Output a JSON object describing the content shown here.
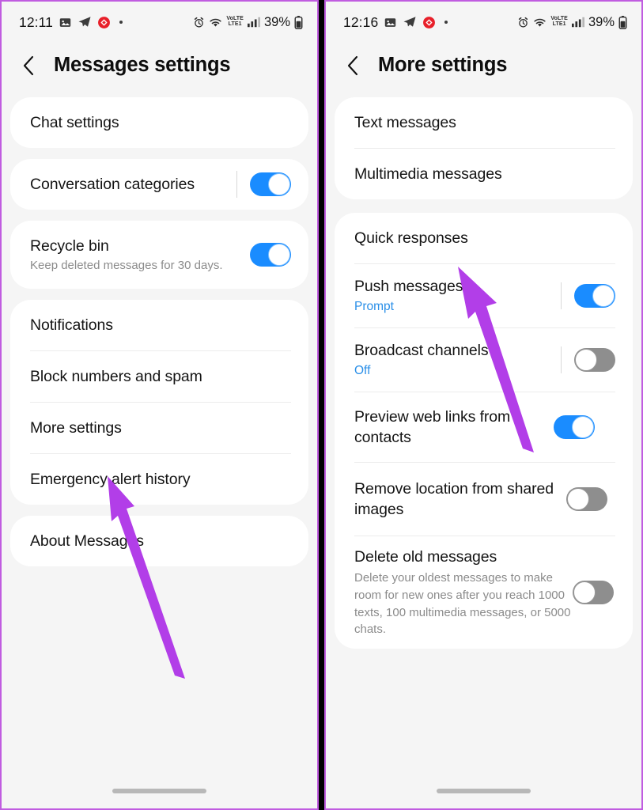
{
  "accent": {
    "toggle_on": "#1a8cff",
    "toggle_off": "#8e8e8e",
    "arrow": "#b23ee8",
    "frame_border": "#c05ce0",
    "link_blue": "#2a8fe8"
  },
  "left_phone": {
    "statusbar": {
      "time": "12:11",
      "battery": "39%",
      "network": "LTE1",
      "volte": "VoLTE",
      "icons_left": [
        "photo-icon",
        "telegram-icon",
        "red-badge-icon",
        "dot-icon"
      ],
      "icons_right": [
        "alarm-icon",
        "wifi-icon",
        "volte-icon",
        "signal-icon",
        "battery-icon"
      ]
    },
    "header": {
      "back": "back-chevron",
      "title": "Messages settings"
    },
    "cards": [
      {
        "rows": [
          {
            "title": "Chat settings",
            "sub": null,
            "toggle": null
          }
        ]
      },
      {
        "rows": [
          {
            "title": "Conversation categories",
            "sub": null,
            "toggle": "on"
          }
        ]
      },
      {
        "rows": [
          {
            "title": "Recycle bin",
            "sub": "Keep deleted messages for 30 days.",
            "toggle": "on"
          }
        ]
      },
      {
        "rows": [
          {
            "title": "Notifications",
            "sub": null,
            "toggle": null
          },
          {
            "title": "Block numbers and spam",
            "sub": null,
            "toggle": null
          },
          {
            "title": "More settings",
            "sub": null,
            "toggle": null
          },
          {
            "title": "Emergency alert history",
            "sub": null,
            "toggle": null
          }
        ]
      },
      {
        "rows": [
          {
            "title": "About Messages",
            "sub": null,
            "toggle": null
          }
        ]
      }
    ]
  },
  "right_phone": {
    "statusbar": {
      "time": "12:16",
      "battery": "39%",
      "network": "LTE1",
      "volte": "VoLTE",
      "icons_left": [
        "photo-icon",
        "telegram-icon",
        "red-badge-icon",
        "dot-icon"
      ],
      "icons_right": [
        "alarm-icon",
        "wifi-icon",
        "volte-icon",
        "signal-icon",
        "battery-icon"
      ]
    },
    "header": {
      "back": "back-chevron",
      "title": "More settings"
    },
    "cards": [
      {
        "rows": [
          {
            "title": "Text messages",
            "sub": null,
            "toggle": null
          },
          {
            "title": "Multimedia messages",
            "sub": null,
            "toggle": null
          }
        ]
      },
      {
        "rows": [
          {
            "title": "Quick responses",
            "sub": null,
            "toggle": null
          },
          {
            "title": "Push messages",
            "sub": "Prompt",
            "sub_accent": true,
            "toggle": "on"
          },
          {
            "title": "Broadcast channels",
            "sub": "Off",
            "sub_accent": true,
            "toggle": "off"
          },
          {
            "title": "Preview web links from contacts",
            "sub": null,
            "toggle": "on"
          },
          {
            "title": "Remove location from shared images",
            "sub": null,
            "toggle": "off"
          },
          {
            "title": "Delete old messages",
            "sub": "Delete your oldest messages to make room for new ones after you reach 1000 texts, 100 multimedia messages, or 5000 chats.",
            "toggle": "off"
          }
        ]
      }
    ]
  },
  "annotations": [
    {
      "name": "arrow-to-more-settings",
      "panel": "left"
    },
    {
      "name": "arrow-to-quick-responses",
      "panel": "right"
    }
  ]
}
